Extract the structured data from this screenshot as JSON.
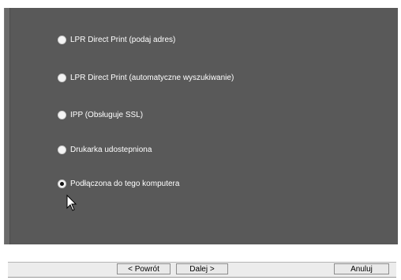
{
  "options": [
    {
      "label": "LPR Direct Print (podaj adres)",
      "checked": false
    },
    {
      "label": "LPR Direct Print (automatyczne wyszukiwanie)",
      "checked": false
    },
    {
      "label": "IPP (Obsługuje SSL)",
      "checked": false
    },
    {
      "label": "Drukarka udostepniona",
      "checked": false
    },
    {
      "label": "Podłączona do tego komputera",
      "checked": true
    }
  ],
  "buttons": {
    "back": "< Powrót",
    "next": "Dalej >",
    "cancel": "Anuluj"
  },
  "colors": {
    "panel": "#595959",
    "text": "#ffffff"
  },
  "icons": {
    "cursor": "mouse-pointer-icon",
    "radio": "radio-button-icon"
  }
}
